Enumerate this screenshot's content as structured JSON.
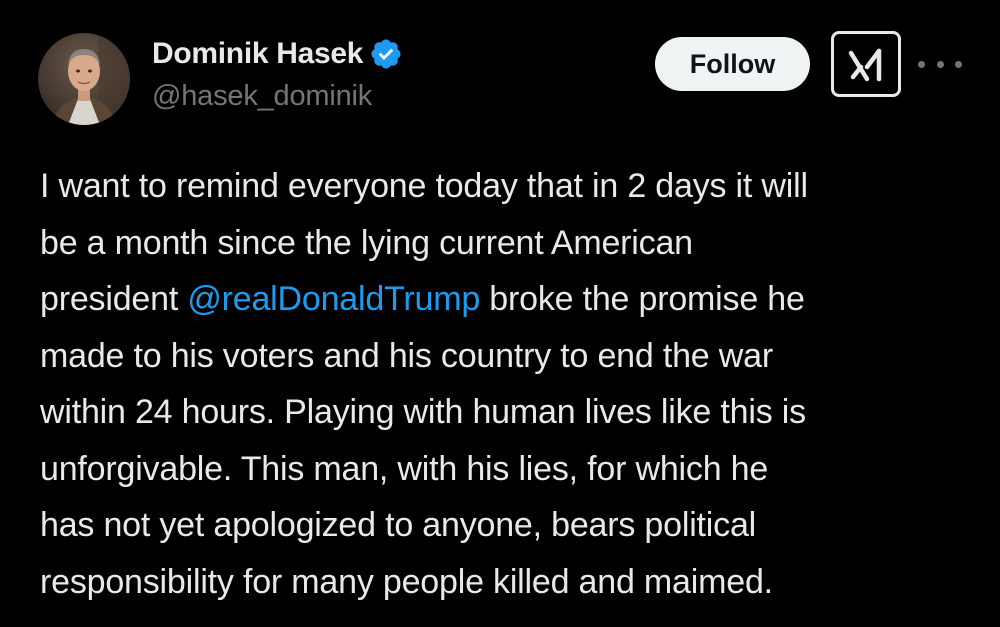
{
  "author": {
    "display_name": "Dominik Hasek",
    "handle": "@hasek_dominik",
    "verified": true,
    "avatar_icon": "profile-photo"
  },
  "actions": {
    "follow_label": "Follow",
    "grok_icon": "grok-icon",
    "more_icon": "more-horizontal-icon"
  },
  "tweet": {
    "lines": [
      {
        "before": "I want to remind everyone today that in 2 days it will"
      },
      {
        "before": "be a month since the lying current American"
      },
      {
        "before": "president ",
        "mention": "@realDonaldTrump",
        "after": " broke the promise he"
      },
      {
        "before": "made to his voters and his country to end the war"
      },
      {
        "before": "within 24 hours. Playing with human lives like this is"
      },
      {
        "before": "unforgivable. This man, with his lies, for which he"
      },
      {
        "before": "has not yet apologized to anyone, bears political"
      },
      {
        "before": "responsibility for many people killed and maimed."
      }
    ]
  },
  "colors": {
    "background": "#000000",
    "text": "#e7e9ea",
    "muted": "#71767b",
    "link": "#1d9bf0",
    "verified": "#1d9bf0"
  }
}
